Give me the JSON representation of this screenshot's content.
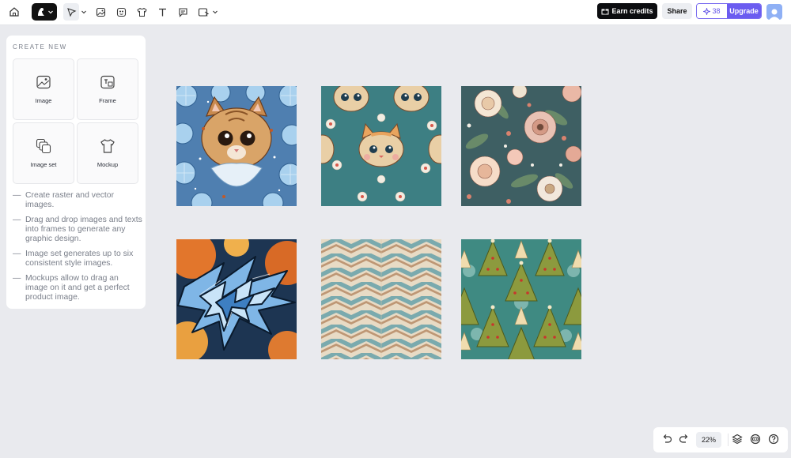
{
  "toolbar": {
    "earn_credits": "Earn credits",
    "share": "Share",
    "credits_count": "38",
    "upgrade": "Upgrade",
    "icons": [
      "home-icon",
      "brand-logo",
      "select-tool-icon",
      "image-tool-icon",
      "image-set-tool-icon",
      "mockup-tool-icon",
      "text-tool-icon",
      "comment-tool-icon",
      "frame-tool-icon"
    ]
  },
  "panel": {
    "title": "CREATE NEW",
    "tiles": [
      {
        "label": "Image",
        "icon": "image-icon"
      },
      {
        "label": "Frame",
        "icon": "frame-icon"
      },
      {
        "label": "Image set",
        "icon": "image-set-icon"
      },
      {
        "label": "Mockup",
        "icon": "tshirt-icon"
      }
    ],
    "tips": [
      "Create raster and vector images.",
      "Drag and drop images and texts into frames to generate any graphic design.",
      "Image set generates up to six consistent style images.",
      "Mockups allow to drag an image on it and get a perfect product image."
    ]
  },
  "canvas": {
    "images": [
      "cat-snowflake-pattern",
      "cats-flowers-pattern",
      "floral-pattern",
      "graffiti-pattern",
      "chevron-pattern",
      "christmas-trees-pattern"
    ]
  },
  "bottom": {
    "zoom": "22%",
    "icons": [
      "undo-icon",
      "redo-icon",
      "layers-icon",
      "help-chat-icon",
      "help-icon"
    ]
  },
  "colors": {
    "accent": "#6b5cf0",
    "dark": "#0c0d10",
    "canvas": "#e9eaee"
  }
}
